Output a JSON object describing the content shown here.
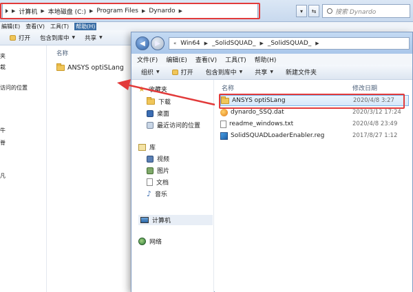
{
  "back_window": {
    "address": [
      "计算机",
      "本地磁盘 (C:)",
      "Program Files",
      "Dynardo"
    ],
    "search_placeholder": "搜索 Dynardo",
    "menu": [
      "編辑(E)",
      "查看(V)",
      "工具(T)",
      "帮助(H)"
    ],
    "toolbar": [
      "打开",
      "包含到库中",
      "共享"
    ],
    "nav_fragments": [
      "夹",
      "栽",
      "访问的位置",
      "牛",
      "脊",
      "凡"
    ],
    "column_name": "名称",
    "item_name": "ANSYS optiSLang"
  },
  "front_window": {
    "address": [
      "Win64",
      "_SolidSQUAD_",
      "_SolidSQUAD_"
    ],
    "menu": [
      "文件(F)",
      "编辑(E)",
      "查看(V)",
      "工具(T)",
      "帮助(H)"
    ],
    "toolbar": [
      "组织",
      "打开",
      "包含到库中",
      "共享",
      "新建文件夹"
    ],
    "nav": {
      "favorites": "收藏夹",
      "downloads": "下载",
      "desktop": "桌面",
      "recent": "最近访问的位置",
      "libraries": "库",
      "videos": "视频",
      "pictures": "图片",
      "documents": "文档",
      "music": "音乐",
      "computer": "计算机",
      "network": "网络"
    },
    "columns": {
      "name": "名称",
      "date": "修改日期"
    },
    "files": [
      {
        "name": "ANSYS optiSLang",
        "date": "2020/4/8 3:27",
        "icon": "folder-icon"
      },
      {
        "name": "dynardo_SSQ.dat",
        "date": "2020/3/12 17:24",
        "icon": "dat-file-icon"
      },
      {
        "name": "readme_windows.txt",
        "date": "2020/4/8 23:49",
        "icon": "text-file-icon"
      },
      {
        "name": "SolidSQUADLoaderEnabler.reg",
        "date": "2017/8/27 1:12",
        "icon": "registry-file-icon"
      }
    ]
  },
  "colors": {
    "annotation": "#e23a3a",
    "accent": "#3a6ea5"
  }
}
